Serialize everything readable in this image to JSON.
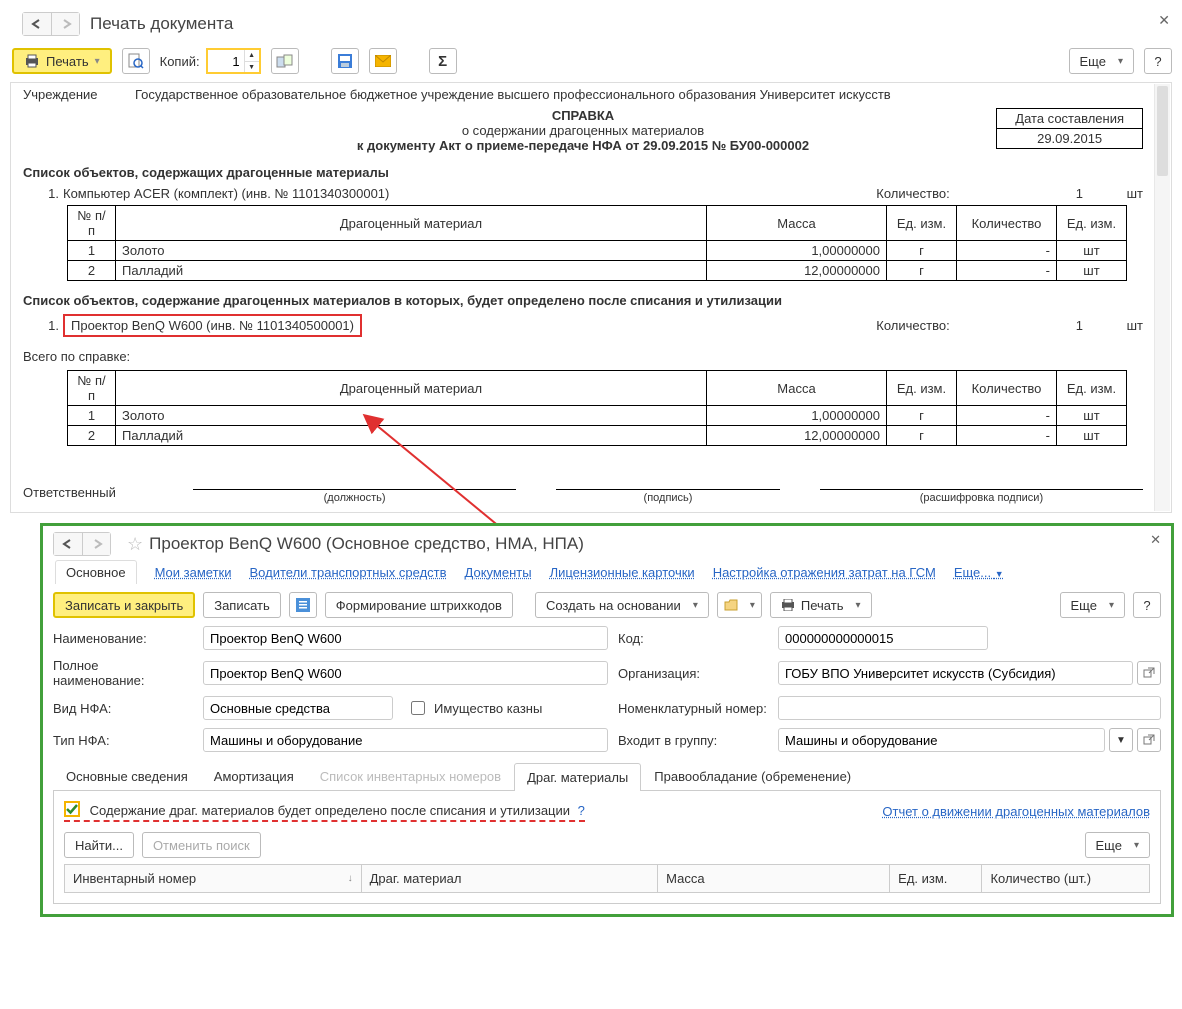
{
  "print_window": {
    "title": "Печать документа",
    "toolbar": {
      "print": "Печать",
      "copies_label": "Копий:",
      "copies_value": "1",
      "more": "Еще"
    },
    "document": {
      "institution_label": "Учреждение",
      "institution_value": "Государственное образовательное бюджетное учреждение высшего профессионального образования  Университет искусств",
      "title": "СПРАВКА",
      "subtitle1": "о содержании драгоценных материалов",
      "subtitle2": "к документу Акт о приеме-передаче НФА от 29.09.2015 № БУ00-000002",
      "date_label": "Дата составления",
      "date_value": "29.09.2015",
      "list1_title": "Список объектов, содержащих драгоценные материалы",
      "list1_items": [
        {
          "num": "1.",
          "name": "Компьютер ACER (комплект) (инв. № 1101340300001)",
          "qty_label": "Количество:",
          "qty": "1",
          "unit": "шт"
        }
      ],
      "mat_headers": {
        "num": "№ п/п",
        "name": "Драгоценный материал",
        "mass": "Масса",
        "unit1": "Ед. изм.",
        "qty": "Количество",
        "unit2": "Ед. изм."
      },
      "mat_rows1": [
        {
          "num": "1",
          "name": "Золото",
          "mass": "1,00000000",
          "unit1": "г",
          "qty": "-",
          "unit2": "шт"
        },
        {
          "num": "2",
          "name": "Палладий",
          "mass": "12,00000000",
          "unit1": "г",
          "qty": "-",
          "unit2": "шт"
        }
      ],
      "list2_title": "Список объектов, содержание драгоценных материалов в которых, будет определено после списания и утилизации",
      "list2_items": [
        {
          "num": "1.",
          "name": "Проектор BenQ W600 (инв. № 1101340500001)",
          "qty_label": "Количество:",
          "qty": "1",
          "unit": "шт"
        }
      ],
      "summary_title": "Всего по справке:",
      "mat_rows2": [
        {
          "num": "1",
          "name": "Золото",
          "mass": "1,00000000",
          "unit1": "г",
          "qty": "-",
          "unit2": "шт"
        },
        {
          "num": "2",
          "name": "Палладий",
          "mass": "12,00000000",
          "unit1": "г",
          "qty": "-",
          "unit2": "шт"
        }
      ],
      "resp_label": "Ответственный",
      "sig_captions": {
        "pos": "(должность)",
        "sign": "(подпись)",
        "name": "(расшифровка подписи)"
      }
    }
  },
  "item_window": {
    "title": "Проектор BenQ W600 (Основное средство, НМА, НПА)",
    "links": {
      "main": "Основное",
      "notes": "Мои заметки",
      "drivers": "Водители транспортных средств",
      "docs": "Документы",
      "lic": "Лицензионные карточки",
      "gsm": "Настройка отражения затрат на ГСМ",
      "more": "Еще..."
    },
    "toolbar": {
      "save_close": "Записать и закрыть",
      "save": "Записать",
      "barcode": "Формирование штрихкодов",
      "create_based": "Создать на основании",
      "print": "Печать",
      "more": "Еще"
    },
    "fields": {
      "name_label": "Наименование:",
      "name_value": "Проектор BenQ W600",
      "fullname_label": "Полное наименование:",
      "fullname_value": "Проектор BenQ W600",
      "nfa_type_label": "Вид НФА:",
      "nfa_type_value": "Основные средства",
      "treasury_label": "Имущество казны",
      "nfa_kind_label": "Тип НФА:",
      "nfa_kind_value": "Машины и оборудование",
      "code_label": "Код:",
      "code_value": "000000000000015",
      "org_label": "Организация:",
      "org_value": "ГОБУ ВПО Университет искусств (Субсидия)",
      "nomenclature_label": "Номенклатурный номер:",
      "nomenclature_value": "",
      "group_label": "Входит в группу:",
      "group_value": "Машины и оборудование"
    },
    "tabs": {
      "t1": "Основные сведения",
      "t2": "Амортизация",
      "t3": "Список инвентарных номеров",
      "t4": "Драг. материалы",
      "t5": "Правообладание (обременение)"
    },
    "pane": {
      "checkbox_label": "Содержание драг. материалов будет определено после списания и утилизации",
      "report_link": "Отчет о движении драгоценных материалов",
      "find": "Найти...",
      "cancel_find": "Отменить поиск",
      "more": "Еще",
      "columns": {
        "inv": "Инвентарный номер",
        "mat": "Драг. материал",
        "mass": "Масса",
        "unit": "Ед. изм.",
        "qty": "Количество (шт.)"
      }
    }
  }
}
